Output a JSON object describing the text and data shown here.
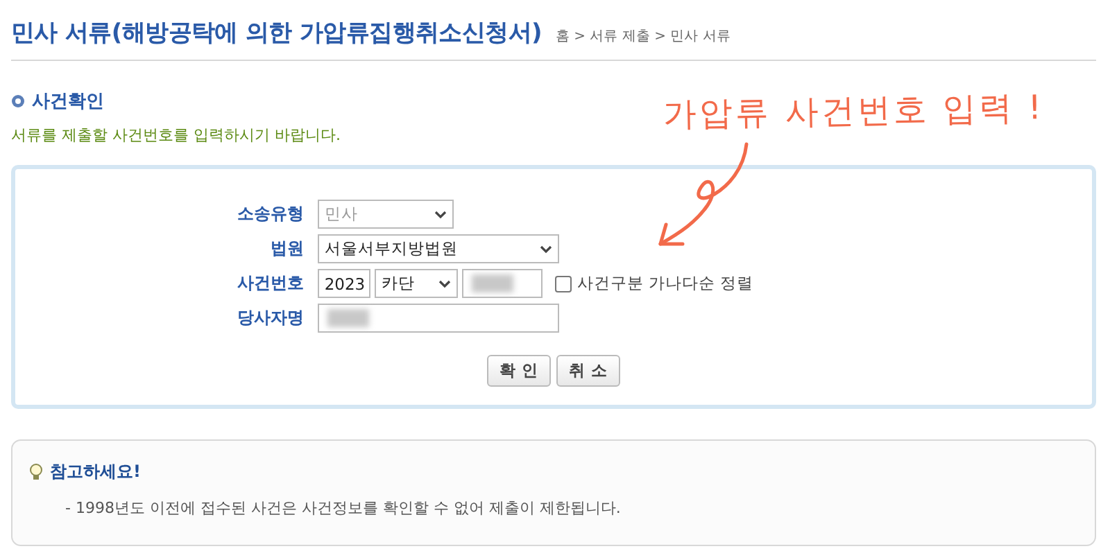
{
  "header": {
    "title": "민사 서류(해방공탁에 의한 가압류집행취소신청서)",
    "breadcrumb": "홈 > 서류 제출 > 민사 서류"
  },
  "section": {
    "title": "사건확인",
    "instruction": "서류를 제출할 사건번호를 입력하시기 바랍니다."
  },
  "annotation": {
    "text": "가압류 사건번호 입력 !"
  },
  "form": {
    "fields": [
      {
        "kind": "select",
        "label": "소송유형",
        "value": "민사",
        "disabled": true
      },
      {
        "kind": "select",
        "label": "법원",
        "value": "서울서부지방법원",
        "disabled": false
      },
      {
        "kind": "case",
        "label": "사건번호",
        "year": "2023",
        "type": "카단",
        "redacted": true,
        "checkbox": {
          "label": "사건구분 가나다순 정렬",
          "checked": false
        }
      },
      {
        "kind": "text",
        "label": "당사자명",
        "redacted": true
      }
    ],
    "buttons": [
      "확 인",
      "취 소"
    ]
  },
  "notice": {
    "title": "참고하세요!",
    "items": [
      "- 1998년도 이전에 접수된 사건은 사건정보를 확인할 수 없어 제출이 제한됩니다."
    ]
  }
}
